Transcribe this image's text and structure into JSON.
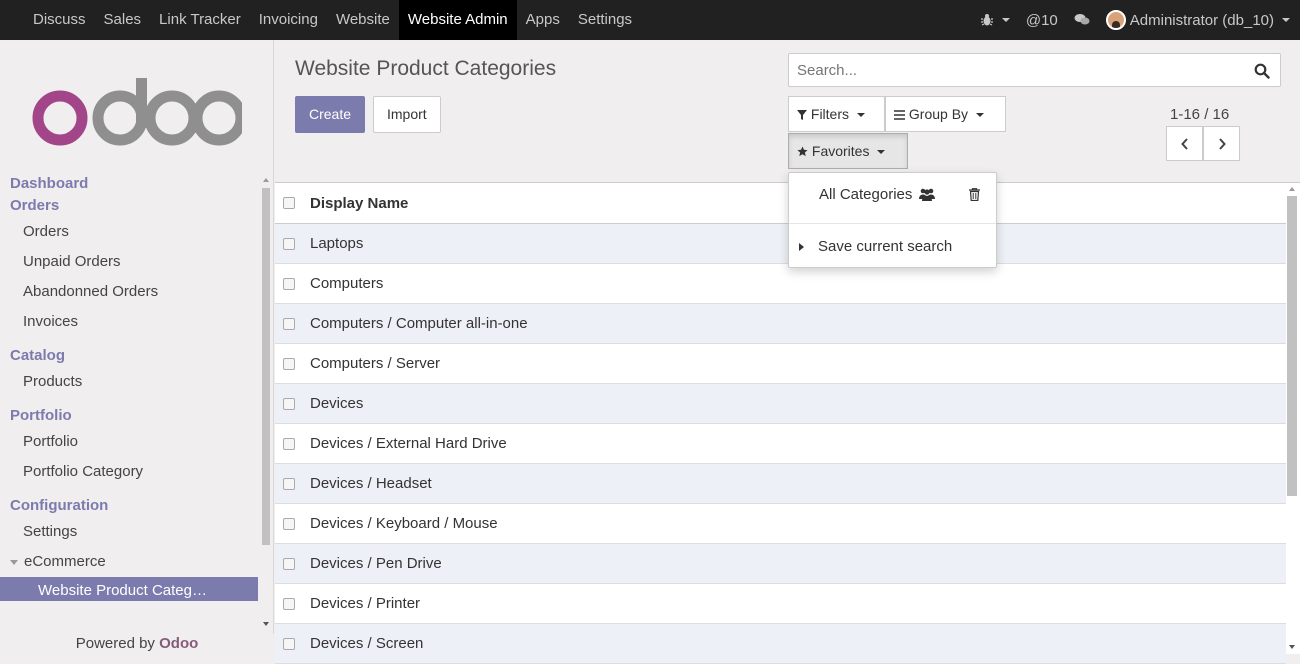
{
  "topbar": {
    "menu": [
      "Discuss",
      "Sales",
      "Link Tracker",
      "Invoicing",
      "Website",
      "Website Admin",
      "Apps",
      "Settings"
    ],
    "active_index": 5,
    "messages_count": "@10",
    "user": "Administrator (db_10)"
  },
  "sidebar": {
    "logo_text": "odoo",
    "dashboard": "Dashboard",
    "orders_section": "Orders",
    "orders_items": [
      "Orders",
      "Unpaid Orders",
      "Abandonned Orders",
      "Invoices"
    ],
    "catalog_section": "Catalog",
    "catalog_items": [
      "Products"
    ],
    "portfolio_section": "Portfolio",
    "portfolio_items": [
      "Portfolio",
      "Portfolio Category"
    ],
    "config_section": "Configuration",
    "config_items": [
      "Settings"
    ],
    "ecommerce": "eCommerce",
    "active_item": "Website Product Categ…",
    "powered_prefix": "Powered by",
    "powered_brand": "Odoo"
  },
  "control_panel": {
    "title": "Website Product Categories",
    "create_label": "Create",
    "import_label": "Import",
    "search_placeholder": "Search...",
    "filters_label": "Filters",
    "groupby_label": "Group By",
    "favorites_label": "Favorites",
    "pager": "1-16 / 16"
  },
  "favorites_dropdown": {
    "saved_filter": "All Categories",
    "save_current": "Save current search"
  },
  "table": {
    "header": "Display Name",
    "rows": [
      "Laptops",
      "Computers",
      "Computers / Computer all-in-one",
      "Computers / Server",
      "Devices",
      "Devices / External Hard Drive",
      "Devices / Headset",
      "Devices / Keyboard / Mouse",
      "Devices / Pen Drive",
      "Devices / Printer",
      "Devices / Screen"
    ]
  },
  "colors": {
    "brand": "#7c7bad",
    "topbar": "#212121",
    "logo_o": "#a24689",
    "logo_doo": "#8f8f8f"
  }
}
